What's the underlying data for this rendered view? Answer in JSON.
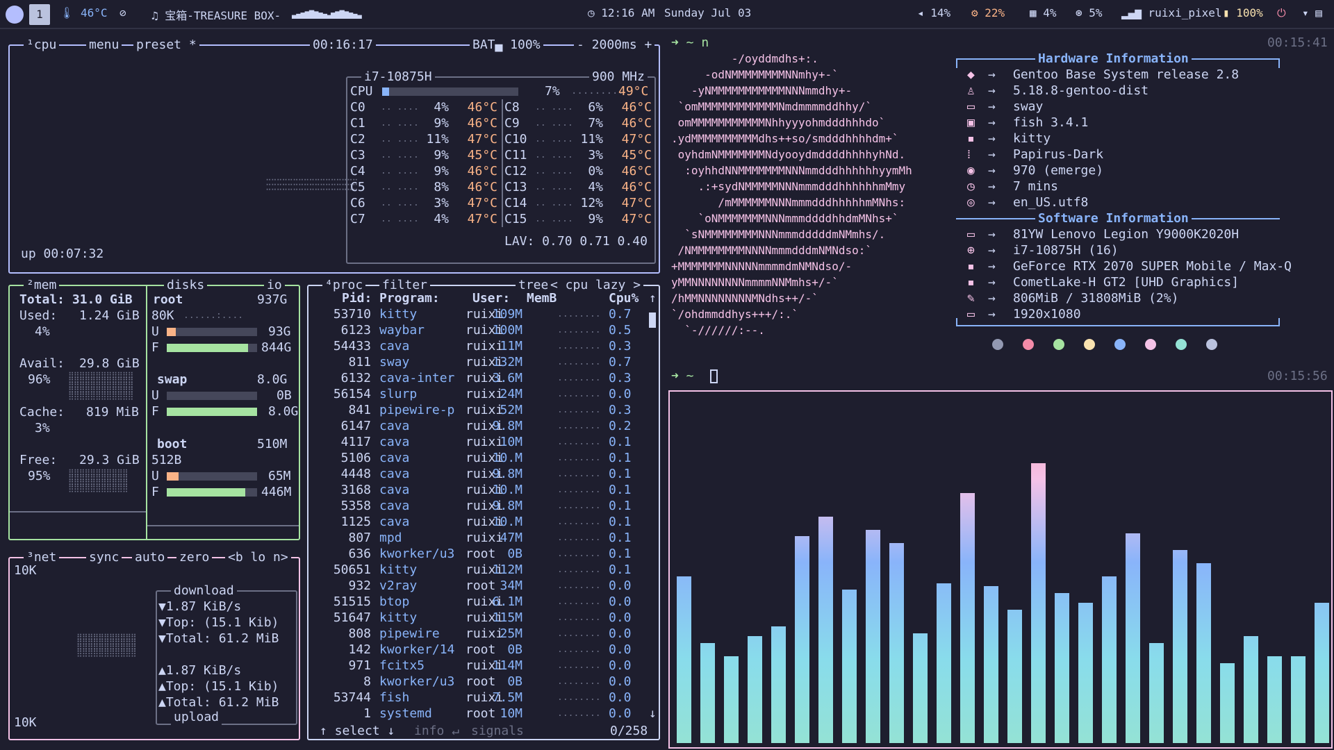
{
  "topbar": {
    "workspace": "1",
    "temp": "🌡 46°C",
    "mute_icon": "⊘",
    "now_playing": "♫ 宝箱-TREASURE BOX-",
    "clock": "◷ 12:16 AM",
    "date": "Sunday Jul 03",
    "volume": "◂ 14%",
    "cpu": "⚙ 22%",
    "mem": "▦ 4%",
    "disk": "⊛ 5%",
    "wifi": "▂▄▆ ruixi_pixel",
    "battery": "▮ 100%",
    "power": "⏻",
    "tray": "▾ ▤"
  },
  "btop": {
    "cpu_box": {
      "tabs": [
        "¹cpu",
        "menu",
        "preset *"
      ],
      "clock": "00:16:17",
      "battery": "BAT▄ 100%",
      "interval": "- 2000ms +",
      "uptime": "up 00:07:32",
      "model": "i7-10875H",
      "freq": "900 MHz",
      "total_label": "CPU",
      "total_pct": "7%",
      "total_temp": "49°C",
      "cores_left": [
        {
          "n": "C0",
          "p": "4%",
          "t": "46°C"
        },
        {
          "n": "C1",
          "p": "9%",
          "t": "46°C"
        },
        {
          "n": "C2",
          "p": "11%",
          "t": "47°C"
        },
        {
          "n": "C3",
          "p": "9%",
          "t": "45°C"
        },
        {
          "n": "C4",
          "p": "9%",
          "t": "46°C"
        },
        {
          "n": "C5",
          "p": "8%",
          "t": "46°C"
        },
        {
          "n": "C6",
          "p": "3%",
          "t": "47°C"
        },
        {
          "n": "C7",
          "p": "4%",
          "t": "47°C"
        }
      ],
      "cores_right": [
        {
          "n": "C8",
          "p": "6%",
          "t": "46°C"
        },
        {
          "n": "C9",
          "p": "7%",
          "t": "46°C"
        },
        {
          "n": "C10",
          "p": "11%",
          "t": "47°C"
        },
        {
          "n": "C11",
          "p": "3%",
          "t": "45°C"
        },
        {
          "n": "C12",
          "p": "0%",
          "t": "46°C"
        },
        {
          "n": "C13",
          "p": "4%",
          "t": "46°C"
        },
        {
          "n": "C14",
          "p": "12%",
          "t": "47°C"
        },
        {
          "n": "C15",
          "p": "9%",
          "t": "47°C"
        }
      ],
      "lav": "LAV: 0.70 0.71 0.40"
    },
    "mem_box": {
      "tabs": [
        "²mem",
        "disks",
        "io"
      ],
      "total": "Total: 31.0 GiB",
      "used": "Used:",
      "used_val": "1.24 GiB",
      "used_pct": "4%",
      "avail": "Avail:",
      "avail_val": "29.8 GiB",
      "avail_pct": "96%",
      "cache": "Cache:",
      "cache_val": "819 MiB",
      "cache_pct": "3%",
      "free": "Free:",
      "free_val": "29.3 GiB",
      "free_pct": "95%",
      "root": "root",
      "root_size": "937G",
      "root_io": "80K",
      "root_u": "93G",
      "root_f": "844G",
      "root_u_frac": 0.1,
      "root_f_frac": 0.9,
      "swap": "swap",
      "swap_size": "8.0G",
      "swap_u": "0B",
      "swap_f": "8.0G",
      "swap_f_frac": 1.0,
      "boot": "boot",
      "boot_size": "510M",
      "boot_io": "512B",
      "boot_u": "65M",
      "boot_f": "446M",
      "boot_u_frac": 0.13,
      "boot_f_frac": 0.87
    },
    "net_box": {
      "tabs": [
        "³net",
        "sync",
        "auto",
        "zero",
        "<b lo n>"
      ],
      "top_scale": "10K",
      "bottom_scale": "10K",
      "download_label": "download",
      "dl_rate": "▼1.87 KiB/s",
      "dl_top": "▼Top: (15.1 Kib)",
      "dl_total": "▼Total: 61.2 MiB",
      "ul_rate": "▲1.87 KiB/s",
      "ul_top": "▲Top: (15.1 Kib)",
      "ul_total": "▲Total: 61.2 MiB",
      "upload_label": "upload"
    },
    "proc_box": {
      "tabs": [
        "⁴proc",
        "filter",
        "tree",
        "< cpu lazy >"
      ],
      "headers": {
        "pid": "Pid:",
        "prog": "Program:",
        "user": "User:",
        "mem": "MemB",
        "cpu": "Cpu%"
      },
      "rows": [
        {
          "pid": "53710",
          "prog": "kitty",
          "user": "ruixi",
          "mem": "109M",
          "cpu": "0.7"
        },
        {
          "pid": "6123",
          "prog": "waybar",
          "user": "ruixi",
          "mem": "100M",
          "cpu": "0.5"
        },
        {
          "pid": "54433",
          "prog": "cava",
          "user": "ruixi",
          "mem": "11M",
          "cpu": "0.3"
        },
        {
          "pid": "811",
          "prog": "sway",
          "user": "ruixi",
          "mem": "132M",
          "cpu": "0.7"
        },
        {
          "pid": "6132",
          "prog": "cava-inter",
          "user": "ruixi",
          "mem": "3.6M",
          "cpu": "0.3"
        },
        {
          "pid": "56154",
          "prog": "slurp",
          "user": "ruixi",
          "mem": "24M",
          "cpu": "0.0"
        },
        {
          "pid": "841",
          "prog": "pipewire-p",
          "user": "ruixi",
          "mem": "52M",
          "cpu": "0.3"
        },
        {
          "pid": "6147",
          "prog": "cava",
          "user": "ruixi",
          "mem": "9.8M",
          "cpu": "0.2"
        },
        {
          "pid": "4117",
          "prog": "cava",
          "user": "ruixi",
          "mem": "10M",
          "cpu": "0.1"
        },
        {
          "pid": "5106",
          "prog": "cava",
          "user": "ruixi",
          "mem": "10.M",
          "cpu": "0.1"
        },
        {
          "pid": "4448",
          "prog": "cava",
          "user": "ruixi",
          "mem": "9.8M",
          "cpu": "0.1"
        },
        {
          "pid": "3168",
          "prog": "cava",
          "user": "ruixi",
          "mem": "10.M",
          "cpu": "0.1"
        },
        {
          "pid": "5358",
          "prog": "cava",
          "user": "ruixi",
          "mem": "9.8M",
          "cpu": "0.1"
        },
        {
          "pid": "1125",
          "prog": "cava",
          "user": "ruixi",
          "mem": "10.M",
          "cpu": "0.1"
        },
        {
          "pid": "807",
          "prog": "mpd",
          "user": "ruixi",
          "mem": "47M",
          "cpu": "0.1"
        },
        {
          "pid": "636",
          "prog": "kworker/u3",
          "user": "root",
          "mem": "0B",
          "cpu": "0.1"
        },
        {
          "pid": "50651",
          "prog": "kitty",
          "user": "ruixi",
          "mem": "112M",
          "cpu": "0.1"
        },
        {
          "pid": "932",
          "prog": "v2ray",
          "user": "root",
          "mem": "34M",
          "cpu": "0.0"
        },
        {
          "pid": "51515",
          "prog": "btop",
          "user": "ruixi",
          "mem": "6.1M",
          "cpu": "0.0"
        },
        {
          "pid": "51647",
          "prog": "kitty",
          "user": "ruixi",
          "mem": "115M",
          "cpu": "0.0"
        },
        {
          "pid": "808",
          "prog": "pipewire",
          "user": "ruixi",
          "mem": "25M",
          "cpu": "0.0"
        },
        {
          "pid": "142",
          "prog": "kworker/14",
          "user": "root",
          "mem": "0B",
          "cpu": "0.0"
        },
        {
          "pid": "971",
          "prog": "fcitx5",
          "user": "ruixi",
          "mem": "114M",
          "cpu": "0.0"
        },
        {
          "pid": "8",
          "prog": "kworker/u3",
          "user": "root",
          "mem": "0B",
          "cpu": "0.0"
        },
        {
          "pid": "53744",
          "prog": "fish",
          "user": "ruixi",
          "mem": "7.5M",
          "cpu": "0.0"
        },
        {
          "pid": "1",
          "prog": "systemd",
          "user": "root",
          "mem": "10M",
          "cpu": "0.0"
        }
      ],
      "footer_select": "↑ select ↓",
      "footer_info": "info ↵",
      "footer_signals": "signals",
      "footer_count": "0/258"
    }
  },
  "neofetch": {
    "prompt1": "➜ ~ n",
    "time1": "00:15:41",
    "prompt2": "➜ ~",
    "time2": "00:15:56",
    "logo_lines": [
      "         -/oyddmdhs+:.",
      "     -odNMMMMMMMMNNmhy+-`",
      "   -yNMMMMMMMMMMMNNNmmdhy+-",
      " `omMMMMMMMMMMMMNmdmmmmddhhy/`",
      " omMMMMMMMMMMMNhhyyyohmdddhhhdo`",
      ".ydMMMMMMMMMMdhs++so/smdddhhhhdm+`",
      " oyhdmNMMMMMMMNdyooydmddddhhhhyhNd.",
      "  :oyhhdNNMMMMMMMNNNmmdddhhhhhhyymMh",
      "    .:+sydNMMMMMNNNmmmdddhhhhhhmMmy",
      "       /mMMMMMMNNNmmmdddhhhhhmMNhs:",
      "    `oNMMMMMMMNNNmmmddddhhdmMNhs+`",
      "  `sNMMMMMMMMNNNmmmdddddmNMmhs/.",
      " /NMMMMMMMMNNNNmmmdddmNMNdso:`",
      "+MMMMMMMNNNNNmmmmdmNMNdso/-",
      "yMMNNNNNNNNmmmmNNMmhs+/-`",
      "/hMMNNNNNNNNMNdhs++/-`",
      "`/ohdmmddhys+++/:.`",
      "  `-//////:--."
    ],
    "hw_title": "Hardware Information",
    "sw_title": "Software Information",
    "hw": [
      {
        "icon": "gentoo-icon",
        "glyph": "◆",
        "text": "Gentoo Base System release 2.8"
      },
      {
        "icon": "linux-icon",
        "glyph": "♙",
        "text": "5.18.8-gentoo-dist"
      },
      {
        "icon": "window-icon",
        "glyph": "▭",
        "text": "sway"
      },
      {
        "icon": "terminal-icon",
        "glyph": "▣",
        "text": "fish 3.4.1"
      },
      {
        "icon": "kitty-icon",
        "glyph": "▪",
        "text": "kitty"
      },
      {
        "icon": "apps-icon",
        "glyph": "⁞",
        "text": "Papirus-Dark"
      },
      {
        "icon": "ghost-icon",
        "glyph": "◉",
        "text": "970 (emerge)"
      },
      {
        "icon": "clock-icon",
        "glyph": "◷",
        "text": "7 mins"
      },
      {
        "icon": "location-icon",
        "glyph": "◎",
        "text": "en_US.utf8"
      }
    ],
    "sw": [
      {
        "icon": "laptop-icon",
        "glyph": "▭",
        "text": "81YW Lenovo Legion Y9000K2020H"
      },
      {
        "icon": "cpu-icon",
        "glyph": "⊕",
        "text": "i7-10875H (16)"
      },
      {
        "icon": "gpu-icon",
        "glyph": "▪",
        "text": "GeForce RTX 2070 SUPER Mobile / Max-Q"
      },
      {
        "icon": "gpu-icon",
        "glyph": "▪",
        "text": "CometLake-H GT2 [UHD Graphics]"
      },
      {
        "icon": "memory-icon",
        "glyph": "✎",
        "text": "806MiB / 31808MiB (2%)"
      },
      {
        "icon": "monitor-icon",
        "glyph": "▭",
        "text": "1920x1080"
      }
    ],
    "arrow": "→",
    "palette": [
      "#9399b2",
      "#f38ba8",
      "#a6e3a1",
      "#f9e2af",
      "#89b4fa",
      "#f5c2e7",
      "#94e2d5",
      "#bac2de"
    ]
  },
  "cava": {
    "levels": [
      0.5,
      0.3,
      0.26,
      0.32,
      0.35,
      0.62,
      0.68,
      0.46,
      0.64,
      0.6,
      0.33,
      0.48,
      0.75,
      0.47,
      0.4,
      0.84,
      0.45,
      0.42,
      0.5,
      0.63,
      0.3,
      0.58,
      0.54,
      0.24,
      0.32,
      0.26,
      0.26,
      0.42
    ]
  }
}
